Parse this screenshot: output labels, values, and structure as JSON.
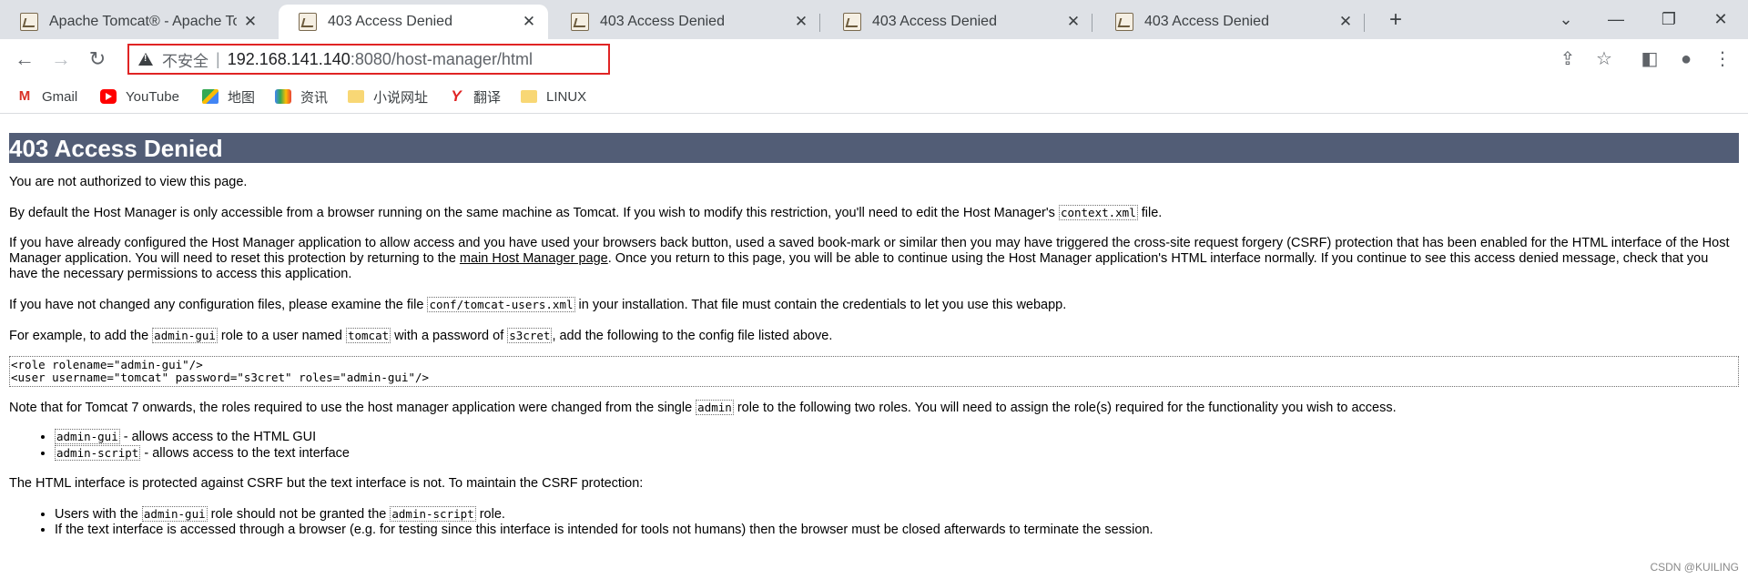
{
  "tabs": [
    {
      "title": "Apache Tomcat® - Apache Tomcat",
      "active": false
    },
    {
      "title": "403 Access Denied",
      "active": true
    },
    {
      "title": "403 Access Denied",
      "active": false
    },
    {
      "title": "403 Access Denied",
      "active": false
    },
    {
      "title": "403 Access Denied",
      "active": false
    }
  ],
  "toolbar": {
    "insecure_label": "不安全",
    "separator": "|",
    "url_host": "192.168.141.140",
    "url_rest": ":8080/host-manager/html"
  },
  "bookmarks": [
    {
      "label": "Gmail",
      "icon": "gmail-icon"
    },
    {
      "label": "YouTube",
      "icon": "youtube-icon"
    },
    {
      "label": "地图",
      "icon": "maps-icon"
    },
    {
      "label": "资讯",
      "icon": "news-icon"
    },
    {
      "label": "小说网址",
      "icon": "folder-icon"
    },
    {
      "label": "翻译",
      "icon": "translate-icon"
    },
    {
      "label": "LINUX",
      "icon": "folder-icon"
    }
  ],
  "page": {
    "heading": "403 Access Denied",
    "p1": "You are not authorized to view this page.",
    "p2_a": "By default the Host Manager is only accessible from a browser running on the same machine as Tomcat. If you wish to modify this restriction, you'll need to edit the Host Manager's ",
    "p2_code": "context.xml",
    "p2_b": " file.",
    "p3_a": "If you have already configured the Host Manager application to allow access and you have used your browsers back button, used a saved book-mark or similar then you may have triggered the cross-site request forgery (CSRF) protection that has been enabled for the HTML interface of the Host Manager application. You will need to reset this protection by returning to the ",
    "p3_link": "main Host Manager page",
    "p3_b": ". Once you return to this page, you will be able to continue using the Host Manager application's HTML interface normally. If you continue to see this access denied message, check that you have the necessary permissions to access this application.",
    "p4_a": "If you have not changed any configuration files, please examine the file ",
    "p4_code": "conf/tomcat-users.xml",
    "p4_b": " in your installation. That file must contain the credentials to let you use this webapp.",
    "p5_a": "For example, to add the ",
    "p5_code1": "admin-gui",
    "p5_b": " role to a user named ",
    "p5_code2": "tomcat",
    "p5_c": " with a password of ",
    "p5_code3": "s3cret",
    "p5_d": ", add the following to the config file listed above.",
    "pre_line1": "<role rolename=\"admin-gui\"/>",
    "pre_line2": "<user username=\"tomcat\" password=\"s3cret\" roles=\"admin-gui\"/>",
    "p6_a": "Note that for Tomcat 7 onwards, the roles required to use the host manager application were changed from the single ",
    "p6_code": "admin",
    "p6_b": " role to the following two roles. You will need to assign the role(s) required for the functionality you wish to access.",
    "li1_code": "admin-gui",
    "li1_text": " - allows access to the HTML GUI",
    "li2_code": "admin-script",
    "li2_text": " - allows access to the text interface",
    "p7": "The HTML interface is protected against CSRF but the text interface is not. To maintain the CSRF protection:",
    "li3_a": "Users with the ",
    "li3_code1": "admin-gui",
    "li3_b": " role should not be granted the ",
    "li3_code2": "admin-script",
    "li3_c": " role.",
    "li4": "If the text interface is accessed through a browser (e.g. for testing since this interface is intended for tools not humans) then the browser must be closed afterwards to terminate the session."
  },
  "watermark": "CSDN @KUILING"
}
